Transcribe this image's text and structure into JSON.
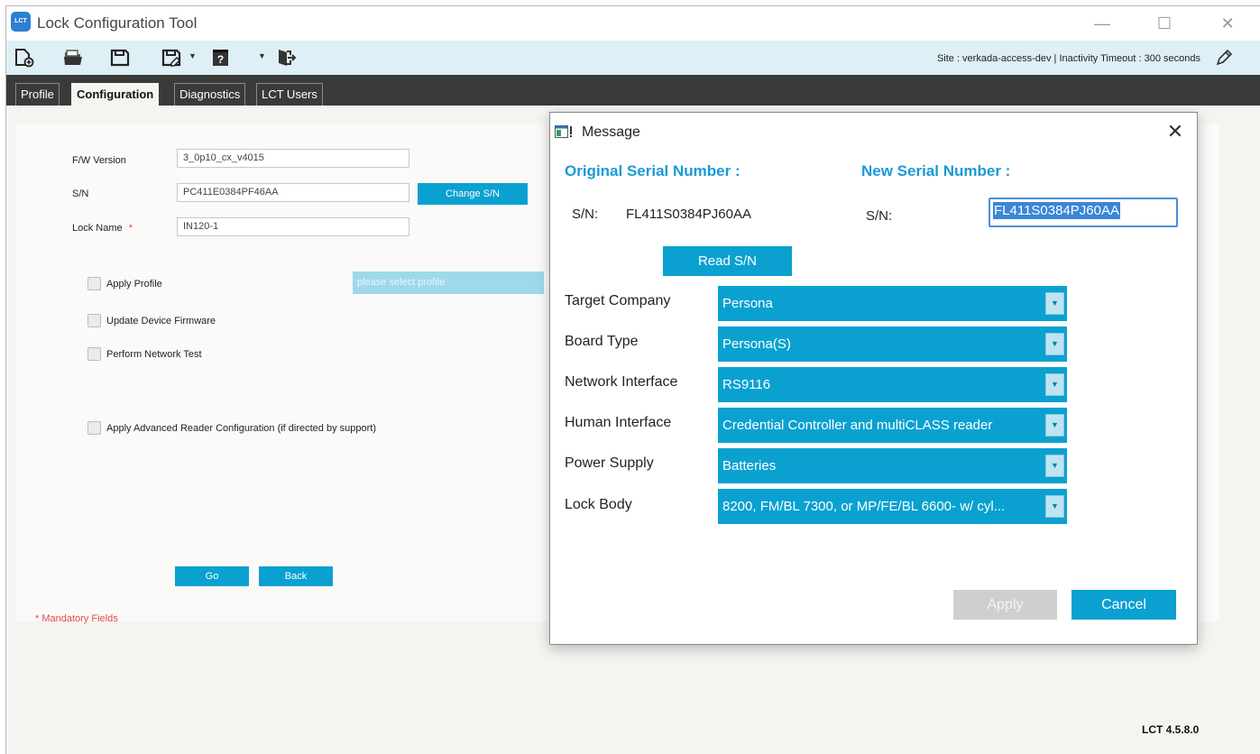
{
  "app": {
    "title": "Lock Configuration Tool",
    "logo_text": "LCT",
    "version": "LCT 4.5.8.0"
  },
  "toolbar": {
    "site_info": "Site :  verkada-access-dev    |    Inactivity Timeout :  300 seconds",
    "icons": [
      "new-file-icon",
      "open-folder-icon",
      "save-icon",
      "save-as-icon",
      "help-icon",
      "logout-icon",
      "pencil-icon"
    ]
  },
  "tabs": [
    {
      "label": "Profile",
      "active": false
    },
    {
      "label": "Configuration",
      "active": true
    },
    {
      "label": "Diagnostics",
      "active": false
    },
    {
      "label": "LCT Users",
      "active": false
    }
  ],
  "form": {
    "fw_label": "F/W Version",
    "fw_value": "3_0p10_cx_v4015",
    "sn_label": "S/N",
    "sn_value": "PC411E0384PF46AA",
    "change_sn_label": "Change S/N",
    "lock_name_label": "Lock Name",
    "lock_name_required": "*",
    "lock_name_value": "IN120-1",
    "apply_profile_label": "Apply Profile",
    "profile_placeholder": "please select profile",
    "update_firmware_label": "Update Device Firmware",
    "network_test_label": "Perform Network Test",
    "advanced_reader_label": "Apply Advanced Reader Configuration (if directed by support)",
    "go_label": "Go",
    "back_label": "Back",
    "mandatory_note": "* Mandatory Fields"
  },
  "dialog": {
    "title": "Message",
    "original_heading": "Original Serial Number :",
    "new_heading": "New Serial Number :",
    "sn_prefix": "S/N:",
    "original_sn": "FL411S0384PJ60AA",
    "new_sn": "FL411S0384PJ60AA",
    "read_sn_label": "Read S/N",
    "rows": [
      {
        "label": "Target Company",
        "value": "Persona"
      },
      {
        "label": "Board Type",
        "value": "Persona(S)"
      },
      {
        "label": "Network Interface",
        "value": "RS9116"
      },
      {
        "label": "Human Interface",
        "value": "Credential Controller and multiCLASS reader"
      },
      {
        "label": "Power Supply",
        "value": "Batteries"
      },
      {
        "label": "Lock Body",
        "value": "8200, FM/BL 7300, or MP/FE/BL 6600- w/ cyl..."
      }
    ],
    "apply_label": "Apply",
    "apply_enabled": false,
    "cancel_label": "Cancel"
  },
  "colors": {
    "accent": "#0aa1d0",
    "heading_blue": "#1a9ad6",
    "tab_bar": "#3a3a3a",
    "toolbar_bg": "#dfeff6",
    "required_red": "#e04a4a"
  }
}
